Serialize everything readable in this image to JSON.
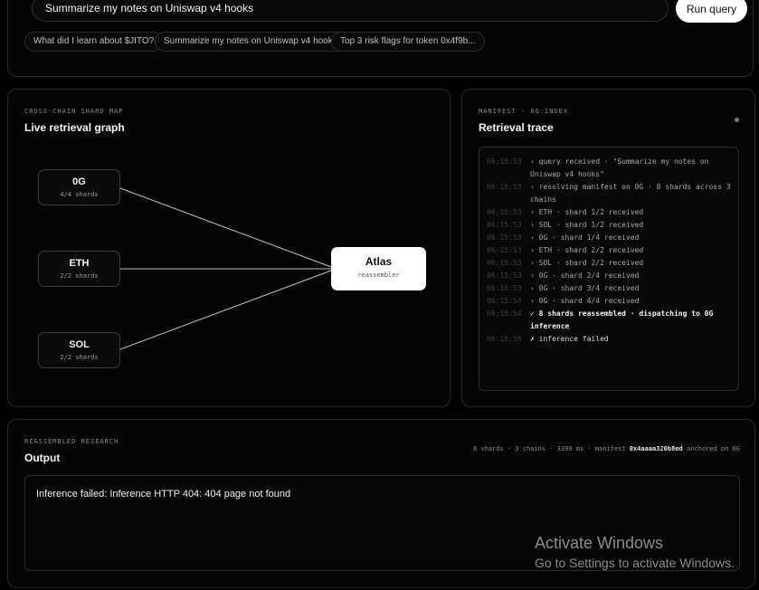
{
  "query": {
    "value": "Summarize my notes on Uniswap v4 hooks",
    "run_label": "Run query",
    "suggestions": [
      "What did I learn about $JITO?",
      "Summarize my notes on Uniswap v4 hooks",
      "Top 3 risk flags for token 0x4f9b..."
    ]
  },
  "graph": {
    "eyebrow": "CROSS-CHAIN SHARD MAP",
    "title": "Live retrieval graph",
    "sources": [
      {
        "name": "0G",
        "shards": "4/4 shards"
      },
      {
        "name": "ETH",
        "shards": "2/2 shards"
      },
      {
        "name": "SOL",
        "shards": "2/2 shards"
      }
    ],
    "target": {
      "name": "Atlas",
      "role": "reassembler"
    }
  },
  "trace": {
    "eyebrow": "MANIFEST · 0G INDEX",
    "title": "Retrieval trace",
    "lines": [
      {
        "time": "06:15:53",
        "msg": "› query received · \"Summarize my notes on Uniswap v4 hooks\"",
        "kind": "info"
      },
      {
        "time": "06:15:53",
        "msg": "› resolving manifest on 0G · 8 shards across 3 chains",
        "kind": "info"
      },
      {
        "time": "06:15:53",
        "msg": "› ETH · shard 1/2 received",
        "kind": "info"
      },
      {
        "time": "06:15:53",
        "msg": "› SOL · shard 1/2 received",
        "kind": "info"
      },
      {
        "time": "06:15:53",
        "msg": "› 0G · shard 1/4 received",
        "kind": "info"
      },
      {
        "time": "06:15:53",
        "msg": "› ETH · shard 2/2 received",
        "kind": "info"
      },
      {
        "time": "06:15:53",
        "msg": "› SOL · shard 2/2 received",
        "kind": "info"
      },
      {
        "time": "06:15:53",
        "msg": "› 0G · shard 2/4 received",
        "kind": "info"
      },
      {
        "time": "06:15:53",
        "msg": "› 0G · shard 3/4 received",
        "kind": "info"
      },
      {
        "time": "06:15:54",
        "msg": "› 0G · shard 4/4 received",
        "kind": "info"
      },
      {
        "time": "06:15:54",
        "msg": "✓ 8 shards reassembled · dispatching to 0G inference",
        "kind": "ok"
      },
      {
        "time": "06:15:56",
        "msg": "✗ inference failed",
        "kind": "fail"
      }
    ]
  },
  "output": {
    "eyebrow": "REASSEMBLED RESEARCH",
    "title": "Output",
    "meta_prefix": "8 shards · 3 chains · 3399 ms · manifest",
    "manifest_id": "0x4aaaa320b8ed",
    "meta_suffix": "anchored on 0G",
    "text": "Inference failed: Inference HTTP 404: 404 page not found"
  },
  "watermark": {
    "title": "Activate Windows",
    "subtitle": "Go to Settings to activate Windows."
  }
}
